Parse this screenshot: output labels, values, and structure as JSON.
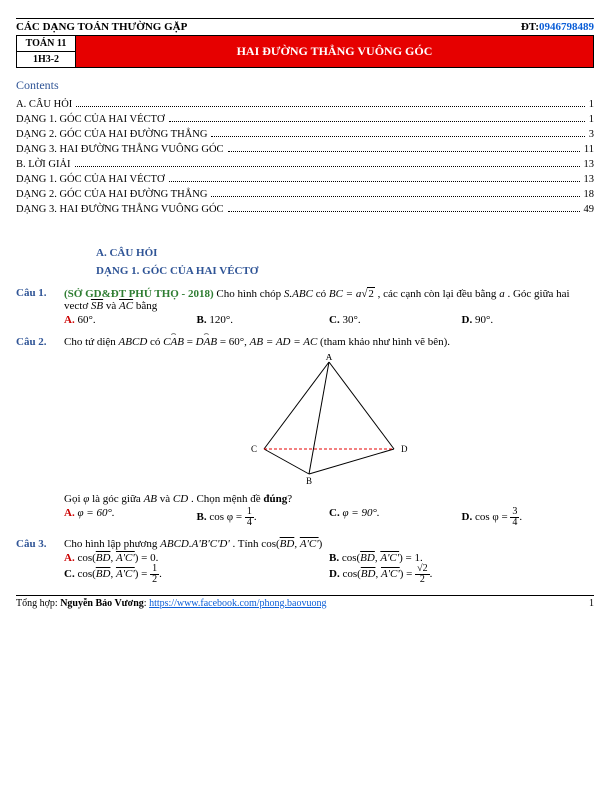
{
  "header": {
    "left": "CÁC DẠNG TOÁN THƯỜNG GẶP",
    "phone_label": "ĐT:",
    "phone": "0946798489"
  },
  "band": {
    "line1": "TOÁN 11",
    "line2": "1H3-2",
    "title": "HAI ĐƯỜNG THẲNG VUÔNG GÓC"
  },
  "contents_heading": "Contents",
  "toc": [
    {
      "label": "A. CÂU HỎI",
      "page": "1"
    },
    {
      "label": "DẠNG 1. GÓC CỦA HAI VÉCTƠ",
      "page": "1"
    },
    {
      "label": "DẠNG 2. GÓC CỦA HAI ĐƯỜNG THẲNG",
      "page": "3"
    },
    {
      "label": "DẠNG 3. HAI ĐƯỜNG THẲNG VUÔNG GÓC",
      "page": "11"
    },
    {
      "label": "B. LỜI GIẢI",
      "page": "13"
    },
    {
      "label": "DẠNG 1. GÓC CỦA HAI VÉCTƠ",
      "page": "13"
    },
    {
      "label": "DẠNG 2. GÓC CỦA HAI ĐƯỜNG THẲNG",
      "page": "18"
    },
    {
      "label": "DẠNG 3. HAI ĐƯỜNG THẲNG VUÔNG GÓC",
      "page": "49"
    }
  ],
  "sections": {
    "a": "A. CÂU HỎI",
    "d1": "DẠNG 1. GÓC CỦA HAI VÉCTƠ"
  },
  "q1": {
    "num": "Câu 1.",
    "source": "(SỞ GD&ĐT PHÚ THỌ - 2018)",
    "text1": "Cho hình chóp ",
    "expr1": "S.ABC",
    "text2": " có ",
    "expr2": "BC = a",
    "sqrt": "2",
    "text3": ", các cạnh còn lại đều bằng ",
    "expr3": "a",
    "text4": ". Góc giữa hai vectơ ",
    "v1": "SB",
    "text5": " và ",
    "v2": "AC",
    "text6": " bằng",
    "opts": {
      "A": "60°.",
      "B": "120°.",
      "C": "30°.",
      "D": "90°."
    }
  },
  "q2": {
    "num": "Câu 2.",
    "text1": "Cho tứ diện ",
    "e1": "ABCD",
    "text2": " có ",
    "hat1": "CAB",
    "eq": " = ",
    "hat2": "DAB",
    "text3": " = 60°,  ",
    "e2": "AB = AD = AC",
    "text4": "  (tham khảo như hình vẽ bên).",
    "line2a": "Gọi ",
    "phi": "φ",
    "line2b": " là góc giữa ",
    "e3": "AB",
    "line2c": " và ",
    "e4": "CD",
    "line2d": ". Chọn mệnh đề ",
    "dung": "đúng",
    "line2e": "?",
    "opts": {
      "A": "φ = 60°.",
      "Bpre": "cos φ = ",
      "Bnum": "1",
      "Bden": "4",
      "Bpost": ".",
      "C": "φ = 90°.",
      "Dpre": "cos φ = ",
      "Dnum": "3",
      "Dden": "4",
      "Dpost": "."
    },
    "fig": {
      "A": "A",
      "B": "B",
      "C": "C",
      "D": "D"
    }
  },
  "q3": {
    "num": "Câu 3.",
    "text1": "Cho hình lập phương ",
    "e1": "ABCD.A'B'C'D'",
    "text2": ". Tính cos(",
    "v1": "BD",
    "comma": ", ",
    "v2": "A'C'",
    "text3": ")",
    "opt": {
      "Apre": "cos(",
      "Amid": ") = 0.",
      "Bpre": "cos(",
      "Bmid": ") = 1.",
      "Cpre": "cos(",
      "Cnum": "1",
      "Cden": "2",
      "Cpost": ".",
      "Dpre": "cos(",
      "Dmid": ") = ",
      "Dnum": "√2",
      "Dden": "2",
      "Dpost": "."
    }
  },
  "footer": {
    "prefix": "Tổng hợp: ",
    "author": "Nguyễn Bảo Vương",
    "sep": ": ",
    "url": "https://www.facebook.com/phong.baovuong",
    "page": "1"
  }
}
